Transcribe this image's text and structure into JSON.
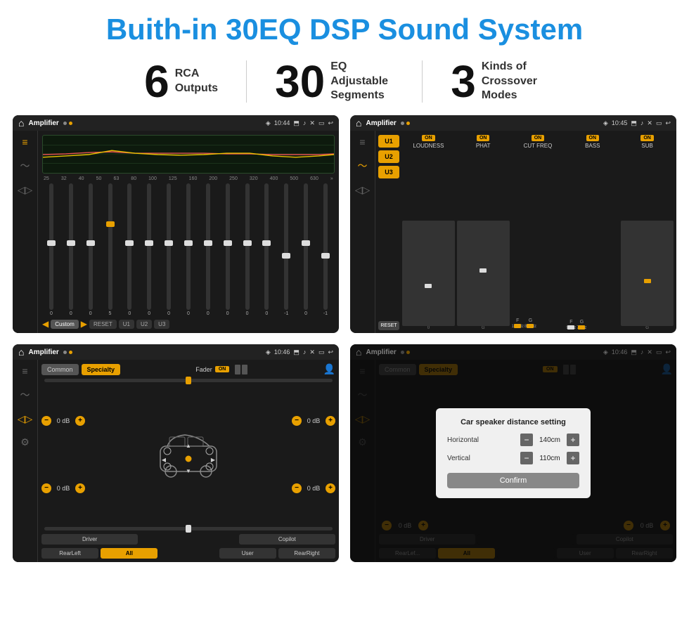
{
  "header": {
    "title": "Buith-in 30EQ DSP Sound System"
  },
  "stats": [
    {
      "number": "6",
      "label": "RCA\nOutputs"
    },
    {
      "number": "30",
      "label": "EQ Adjustable\nSegments"
    },
    {
      "number": "3",
      "label": "Kinds of\nCrossover Modes"
    }
  ],
  "screens": [
    {
      "id": "eq-screen",
      "topbar": {
        "title": "Amplifier",
        "time": "10:44"
      },
      "type": "eq",
      "freqs": [
        "25",
        "32",
        "40",
        "50",
        "63",
        "80",
        "100",
        "125",
        "160",
        "200",
        "250",
        "320",
        "400",
        "500",
        "630"
      ],
      "sliders": [
        0,
        0,
        0,
        5,
        0,
        0,
        0,
        0,
        0,
        0,
        0,
        0,
        -1,
        0,
        -1
      ],
      "preset": "Custom",
      "buttons": [
        "◀",
        "Custom",
        "▶",
        "RESET",
        "U1",
        "U2",
        "U3"
      ]
    },
    {
      "id": "crossover-screen",
      "topbar": {
        "title": "Amplifier",
        "time": "10:45"
      },
      "type": "crossover",
      "u_options": [
        "U1",
        "U2",
        "U3"
      ],
      "channels": [
        {
          "label": "LOUDNESS",
          "on": true
        },
        {
          "label": "PHAT",
          "on": true
        },
        {
          "label": "CUT FREQ",
          "on": true
        },
        {
          "label": "BASS",
          "on": true
        },
        {
          "label": "SUB",
          "on": true
        }
      ]
    },
    {
      "id": "fader-screen",
      "topbar": {
        "title": "Amplifier",
        "time": "10:46"
      },
      "type": "fader",
      "tabs": [
        "Common",
        "Specialty"
      ],
      "activeTab": "Specialty",
      "faderLabel": "Fader",
      "faderOn": true,
      "speakerGroups": [
        {
          "label": "0 dB"
        },
        {
          "label": "0 dB"
        },
        {
          "label": "0 dB"
        },
        {
          "label": "0 dB"
        }
      ],
      "bottomButtons": [
        "Driver",
        "",
        "Copilot",
        "RearLeft",
        "All",
        "",
        "User",
        "RearRight"
      ]
    },
    {
      "id": "distance-screen",
      "topbar": {
        "title": "Amplifier",
        "time": "10:46"
      },
      "type": "distance",
      "tabs": [
        "Common",
        "Specialty"
      ],
      "activeTab": "Specialty",
      "faderOn": true,
      "dialog": {
        "title": "Car speaker distance setting",
        "horizontal": {
          "label": "Horizontal",
          "value": "140cm"
        },
        "vertical": {
          "label": "Vertical",
          "value": "110cm"
        },
        "confirmLabel": "Confirm"
      },
      "speakerGroups": [
        {
          "label": "0 dB"
        },
        {
          "label": "0 dB"
        }
      ],
      "bottomButtons": [
        "Driver",
        "",
        "Copilot",
        "RearLef...",
        "All",
        "",
        "User",
        "RearRight"
      ]
    }
  ]
}
